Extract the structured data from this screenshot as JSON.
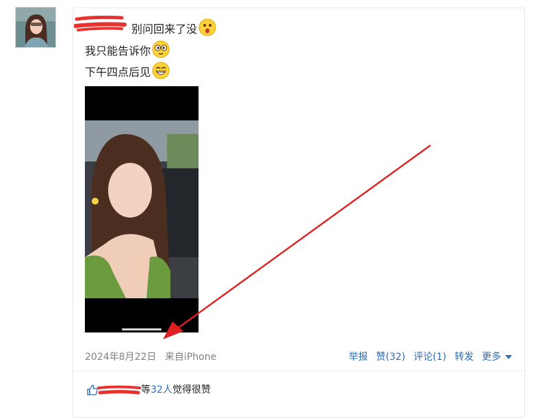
{
  "post": {
    "line1": "别问回来了没",
    "line2": "我只能告诉你",
    "line3": "下午四点后见",
    "emoji1": "surprised-face-emoji",
    "emoji2": "dizzy-eyes-emoji",
    "emoji3": "grinning-face-emoji"
  },
  "meta": {
    "date": "2024年8月22日",
    "source": "来自iPhone"
  },
  "actions": {
    "report": "举报",
    "like": "赞(32)",
    "comment": "评论(1)",
    "repost": "转发",
    "more": "更多"
  },
  "likes": {
    "prefix": "等",
    "count": "32人",
    "suffix": "觉得很赞"
  },
  "colors": {
    "link": "#2b6cb8",
    "meta": "#808080",
    "annotation": "#e02020"
  }
}
